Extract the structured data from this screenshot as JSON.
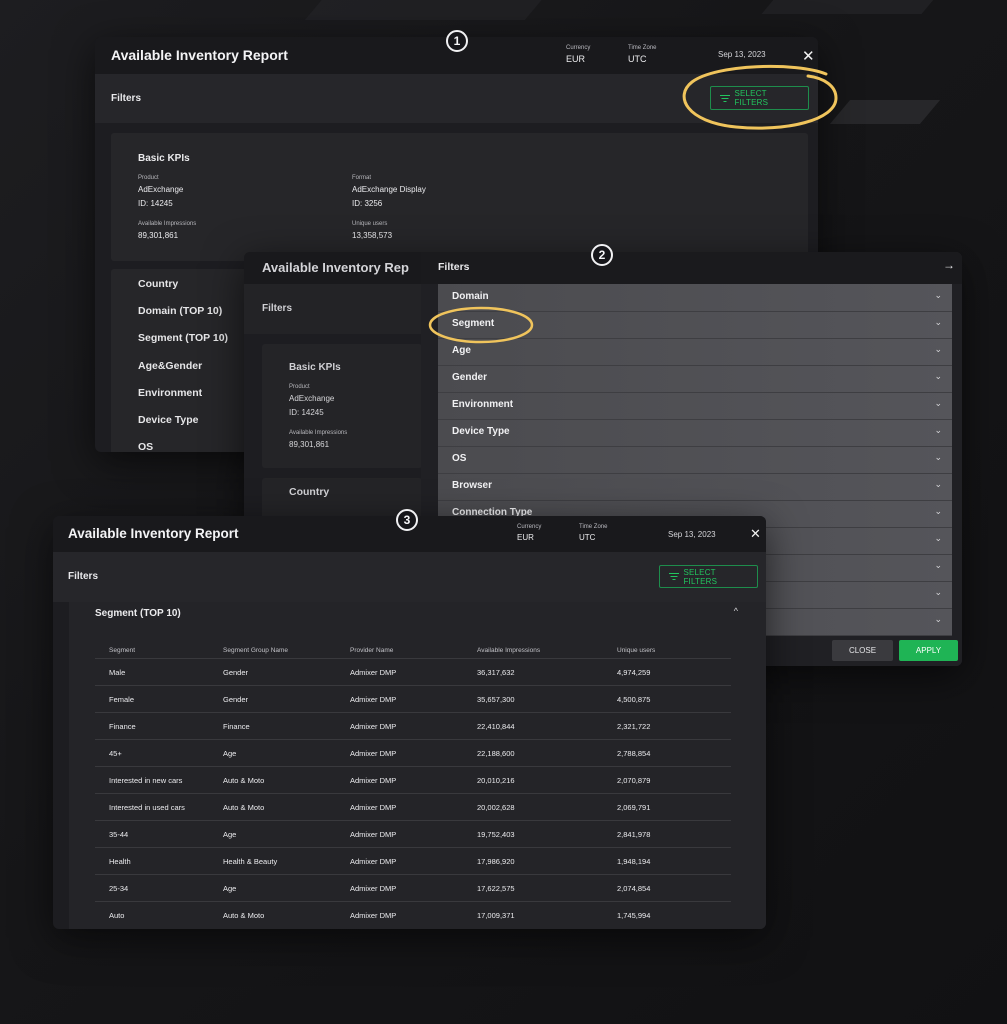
{
  "colors": {
    "accent_green": "#22c55e",
    "highlight_ring": "#f0c45c",
    "apply_bg": "#1fb455"
  },
  "markers": [
    "1",
    "2",
    "3"
  ],
  "report1": {
    "title": "Available Inventory Report",
    "currency_label": "Currency",
    "currency_value": "EUR",
    "timezone_label": "Time Zone",
    "timezone_value": "UTC",
    "date": "Sep 13, 2023",
    "close_icon": "✕",
    "filters_label": "Filters",
    "select_filters": "SELECT FILTERS",
    "kpi_title": "Basic KPIs",
    "product_label": "Product",
    "product_value": "AdExchange",
    "product_id": "ID: 14245",
    "format_label": "Format",
    "format_value": "AdExchange Display",
    "format_id": "ID: 3256",
    "impr_label": "Available Impressions",
    "impr_value": "89,301,861",
    "users_label": "Unique users",
    "users_value": "13,358,573",
    "nav": [
      "Country",
      "Domain (TOP 10)",
      "Segment (TOP 10)",
      "Age&Gender",
      "Environment",
      "Device Type",
      "OS"
    ]
  },
  "report2": {
    "title": "Available Inventory Rep",
    "filters_label": "Filters",
    "kpi_title": "Basic KPIs",
    "product_label": "Product",
    "product_value": "AdExchange",
    "product_id": "ID: 14245",
    "impr_label": "Available Impressions",
    "impr_value": "89,301,861",
    "country": "Country",
    "panel_title": "Filters",
    "panel_arrow": "→",
    "items": [
      "Domain",
      "Segment",
      "Age",
      "Gender",
      "Environment",
      "Device Type",
      "OS",
      "Browser",
      "Connection Type"
    ],
    "chevron": "⌄",
    "close_btn": "CLOSE",
    "apply_btn": "APPLY"
  },
  "report3": {
    "title": "Available Inventory Report",
    "currency_label": "Currency",
    "currency_value": "EUR",
    "timezone_label": "Time Zone",
    "timezone_value": "UTC",
    "date": "Sep 13, 2023",
    "close_icon": "✕",
    "filters_label": "Filters",
    "select_filters": "SELECT FILTERS",
    "segment_title": "Segment (TOP 10)",
    "caret": "^",
    "columns": [
      "Segment",
      "Segment Group Name",
      "Provider Name",
      "Available Impressions",
      "Unique users"
    ],
    "rows": [
      [
        "Male",
        "Gender",
        "Admixer DMP",
        "36,317,632",
        "4,974,259"
      ],
      [
        "Female",
        "Gender",
        "Admixer DMP",
        "35,657,300",
        "4,500,875"
      ],
      [
        "Finance",
        "Finance",
        "Admixer DMP",
        "22,410,844",
        "2,321,722"
      ],
      [
        "45+",
        "Age",
        "Admixer DMP",
        "22,188,600",
        "2,788,854"
      ],
      [
        "Interested in new cars",
        "Auto & Moto",
        "Admixer DMP",
        "20,010,216",
        "2,070,879"
      ],
      [
        "Interested in used cars",
        "Auto & Moto",
        "Admixer DMP",
        "20,002,628",
        "2,069,791"
      ],
      [
        "35-44",
        "Age",
        "Admixer DMP",
        "19,752,403",
        "2,841,978"
      ],
      [
        "Health",
        "Health & Beauty",
        "Admixer DMP",
        "17,986,920",
        "1,948,194"
      ],
      [
        "25-34",
        "Age",
        "Admixer DMP",
        "17,622,575",
        "2,074,854"
      ],
      [
        "Auto",
        "Auto & Moto",
        "Admixer DMP",
        "17,009,371",
        "1,745,994"
      ]
    ]
  }
}
